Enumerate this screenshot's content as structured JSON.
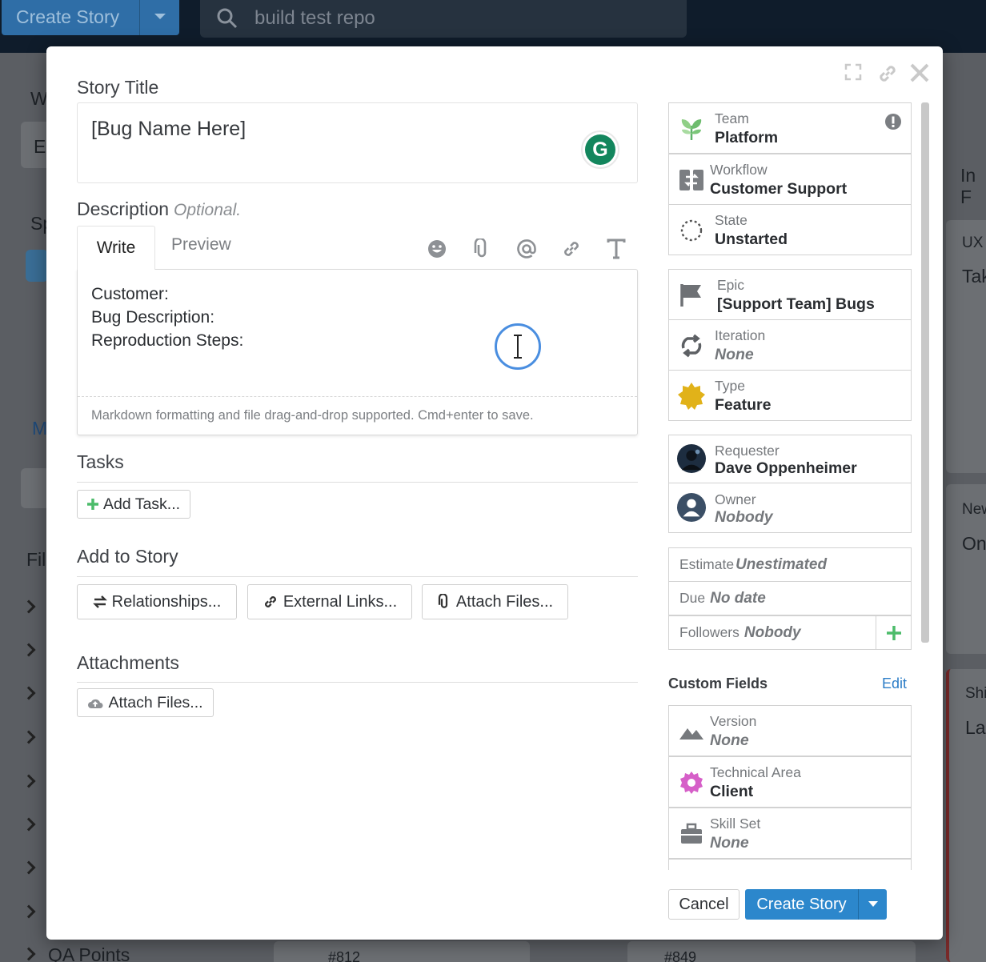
{
  "background": {
    "create_story_label": "Create Story",
    "search_text": "build test repo",
    "side_letters": [
      "W",
      "E",
      "Sp",
      "M",
      "Fil"
    ],
    "qa_points_label": "QA Points",
    "right_peek": [
      "In F",
      "UX",
      "Tak",
      "New",
      "On",
      "Shi",
      "La"
    ],
    "card_ids": [
      "#812",
      "#849"
    ]
  },
  "modal": {
    "story_title_label": "Story Title",
    "story_title_value": "[Bug Name Here]",
    "grammarly_letter": "G",
    "description_label": "Description",
    "description_optional": "Optional.",
    "tabs": {
      "write": "Write",
      "preview": "Preview"
    },
    "description_lines": [
      "Customer:",
      "Bug Description:",
      "Reproduction Steps:"
    ],
    "description_footer": "Markdown formatting and file drag-and-drop supported. Cmd+enter to save.",
    "tasks_label": "Tasks",
    "add_task_label": "Add Task...",
    "add_to_story_label": "Add to Story",
    "relationships_label": "Relationships...",
    "external_links_label": "External Links...",
    "attach_files_label": "Attach Files...",
    "attachments_label": "Attachments",
    "attachments_attach_label": "Attach Files..."
  },
  "sidebar": {
    "team": {
      "label": "Team",
      "value": "Platform"
    },
    "workflow": {
      "label": "Workflow",
      "value": "Customer Support"
    },
    "state": {
      "label": "State",
      "value": "Unstarted"
    },
    "epic": {
      "label": "Epic",
      "value": "[Support Team] Bugs"
    },
    "iteration": {
      "label": "Iteration",
      "value": "None"
    },
    "type": {
      "label": "Type",
      "value": "Feature"
    },
    "requester": {
      "label": "Requester",
      "value": "Dave Oppenheimer"
    },
    "owner": {
      "label": "Owner",
      "value": "Nobody"
    },
    "estimate": {
      "label": "Estimate",
      "value": "Unestimated"
    },
    "due": {
      "label": "Due",
      "value": "No date"
    },
    "followers": {
      "label": "Followers",
      "value": "Nobody"
    },
    "custom_fields_label": "Custom Fields",
    "custom_fields_edit": "Edit",
    "version": {
      "label": "Version",
      "value": "None"
    },
    "technical_area": {
      "label": "Technical Area",
      "value": "Client"
    },
    "skill_set": {
      "label": "Skill Set",
      "value": "None"
    }
  },
  "footer": {
    "cancel": "Cancel",
    "create": "Create Story"
  },
  "colors": {
    "primary": "#2c87cc",
    "add_green": "#4cbc6a",
    "type_star": "#e1b219",
    "tech_area": "#d65fc8"
  }
}
